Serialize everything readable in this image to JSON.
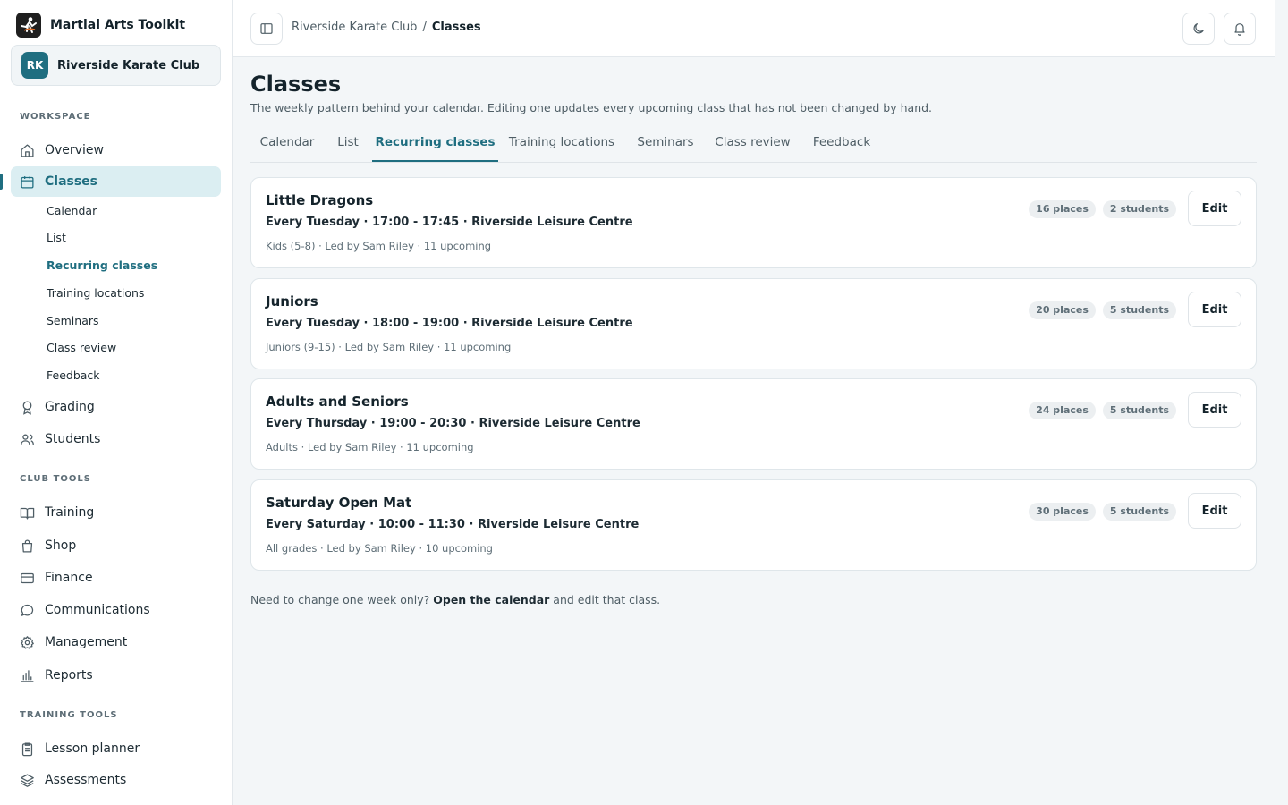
{
  "brand": {
    "name": "Martial Arts Toolkit"
  },
  "club": {
    "initials": "RK",
    "name": "Riverside Karate Club"
  },
  "sidebar": {
    "workspace_label": "WORKSPACE",
    "overview": "Overview",
    "classes": "Classes",
    "sub_items": [
      "Calendar",
      "List",
      "Recurring classes",
      "Training locations",
      "Seminars",
      "Class review",
      "Feedback"
    ],
    "grading": "Grading",
    "students": "Students",
    "club_tools_label": "CLUB TOOLS",
    "training": "Training",
    "shop": "Shop",
    "finance": "Finance",
    "communications": "Communications",
    "management": "Management",
    "reports": "Reports",
    "training_tools_label": "TRAINING TOOLS",
    "lesson_planner": "Lesson planner",
    "assessments": "Assessments"
  },
  "breadcrumb": {
    "parent": "Riverside Karate Club",
    "separator": "/",
    "current": "Classes"
  },
  "page": {
    "title": "Classes",
    "description": "The weekly pattern behind your calendar. Editing one updates every upcoming class that has not been changed by hand."
  },
  "tabs": [
    "Calendar",
    "List",
    "Recurring classes",
    "Training locations",
    "Seminars",
    "Class review",
    "Feedback"
  ],
  "classes": [
    {
      "title": "Little Dragons",
      "schedule": "Every Tuesday · 17:00 - 17:45 · Riverside Leisure Centre",
      "meta": "Kids (5-8) · Led by Sam Riley · 11 upcoming",
      "places": "16 places",
      "students": "2 students",
      "edit": "Edit"
    },
    {
      "title": "Juniors",
      "schedule": "Every Tuesday · 18:00 - 19:00 · Riverside Leisure Centre",
      "meta": "Juniors (9-15) · Led by Sam Riley · 11 upcoming",
      "places": "20 places",
      "students": "5 students",
      "edit": "Edit"
    },
    {
      "title": "Adults and Seniors",
      "schedule": "Every Thursday · 19:00 - 20:30 · Riverside Leisure Centre",
      "meta": "Adults · Led by Sam Riley · 11 upcoming",
      "places": "24 places",
      "students": "5 students",
      "edit": "Edit"
    },
    {
      "title": "Saturday Open Mat",
      "schedule": "Every Saturday · 10:00 - 11:30 · Riverside Leisure Centre",
      "meta": "All grades · Led by Sam Riley · 10 upcoming",
      "places": "30 places",
      "students": "5 students",
      "edit": "Edit"
    }
  ],
  "footer": {
    "before": "Need to change one week only?",
    "link": "Open the calendar",
    "after": "and edit that class."
  },
  "colors": {
    "accent": "#1f6e80",
    "active_bg": "#dbeef2",
    "background": "#f3f6f8"
  },
  "icons": [
    "sidebar-toggle-icon",
    "moon-icon",
    "bell-icon",
    "home-icon",
    "calendar-icon",
    "award-icon",
    "users-icon",
    "book-icon",
    "shopping-bag-icon",
    "credit-card-icon",
    "message-icon",
    "gear-icon",
    "bar-chart-icon",
    "clipboard-icon",
    "layers-icon"
  ]
}
